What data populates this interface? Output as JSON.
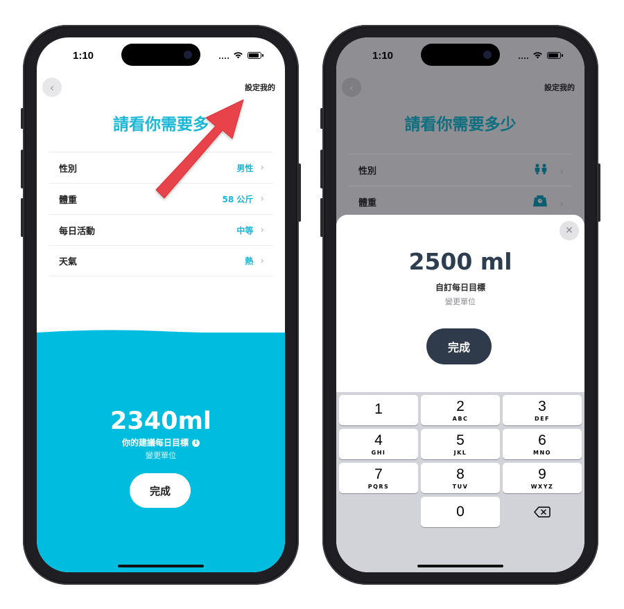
{
  "left_screen": {
    "status_time": "1:10",
    "back_icon": "chevron-left-icon",
    "custom_link": "設定我的",
    "title": "請看你需要多",
    "settings": [
      {
        "label": "性別",
        "value": "男性"
      },
      {
        "label": "體重",
        "value": "58 公斤"
      },
      {
        "label": "每日活動",
        "value": "中等"
      },
      {
        "label": "天氣",
        "value": "熱"
      }
    ],
    "result_value": "2340ml",
    "result_caption": "你的建議每日目標",
    "change_unit": "變更單位",
    "done_label": "完成",
    "water_color": "#00bde0",
    "accent_color": "#13b6d4",
    "annotation_arrow_color": "#e8434a"
  },
  "right_screen": {
    "status_time": "1:10",
    "custom_link": "設定我的",
    "title": "請看你需要多少",
    "settings": [
      {
        "label": "性別",
        "icon": "people-icon"
      },
      {
        "label": "體重",
        "icon": "scale-icon"
      }
    ],
    "sheet": {
      "goal_value": "2500 ml",
      "goal_caption": "自訂每日目標",
      "change_unit": "變更單位",
      "done_label": "完成"
    },
    "keypad": [
      [
        {
          "digit": "1",
          "letters": ""
        },
        {
          "digit": "2",
          "letters": "ABC"
        },
        {
          "digit": "3",
          "letters": "DEF"
        }
      ],
      [
        {
          "digit": "4",
          "letters": "GHI"
        },
        {
          "digit": "5",
          "letters": "JKL"
        },
        {
          "digit": "6",
          "letters": "MNO"
        }
      ],
      [
        {
          "digit": "7",
          "letters": "PQRS"
        },
        {
          "digit": "8",
          "letters": "TUV"
        },
        {
          "digit": "9",
          "letters": "WXYZ"
        }
      ],
      [
        {
          "digit": "",
          "letters": ""
        },
        {
          "digit": "0",
          "letters": ""
        },
        {
          "digit": "",
          "letters": ""
        }
      ]
    ],
    "delete_icon": "backspace-icon",
    "button_dark_color": "#2f3b4a"
  }
}
